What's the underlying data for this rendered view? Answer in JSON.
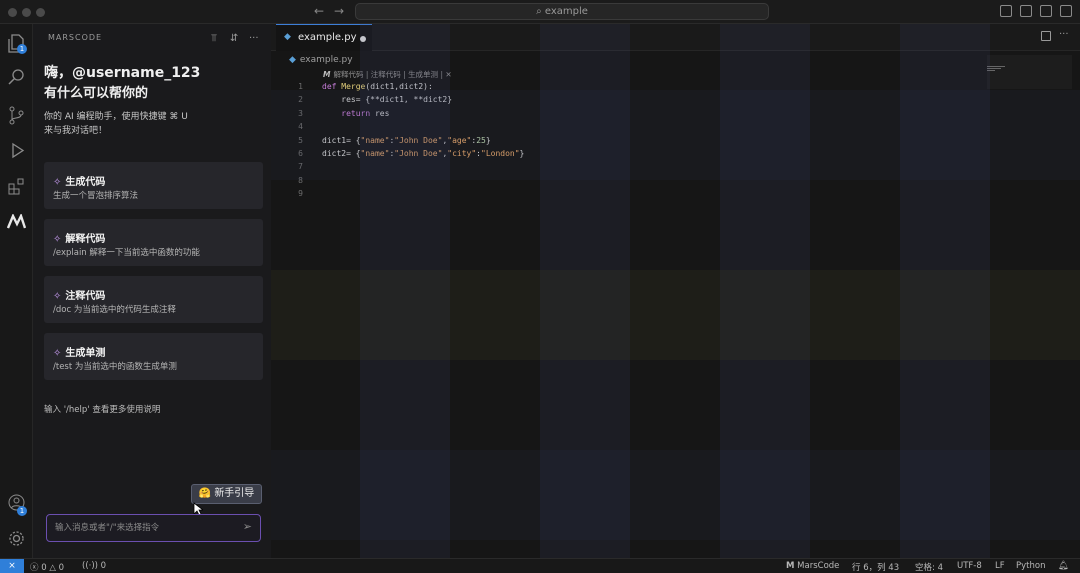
{
  "window": {
    "search_placeholder": "example"
  },
  "activity": {
    "icons": [
      "files-icon",
      "search-icon",
      "source-control-icon",
      "run-debug-icon",
      "extensions-icon",
      "marscode-icon",
      "account-icon",
      "settings-icon"
    ],
    "files_badge": "1",
    "account_badge": "1"
  },
  "panel": {
    "header": "MARSCODE",
    "greeting_line1": "嗨，@username_123",
    "greeting_line2": "有什么可以帮你的",
    "intro": "你的 AI 编程助手，使用快捷键 ⌘ U 来与我对话吧！",
    "cards": [
      {
        "title": "生成代码",
        "subtitle": "生成一个冒泡排序算法"
      },
      {
        "title": "解释代码",
        "subtitle": "/explain 解释一下当前选中函数的功能"
      },
      {
        "title": "注释代码",
        "subtitle": "/doc 为当前选中的代码生成注释"
      },
      {
        "title": "生成单测",
        "subtitle": "/test 为当前选中的函数生成单测"
      }
    ],
    "help_hint": "输入 '/help' 查看更多使用说明",
    "guide_button": "新手引导",
    "guide_emoji": "🤗",
    "input_placeholder": "输入消息或者\"/\"来选择指令"
  },
  "editor": {
    "tab_label": "example.py",
    "breadcrumb": "example.py",
    "codelens": [
      "解释代码",
      "注释代码",
      "生成单测"
    ],
    "codelens_brand": "M",
    "line_numbers": [
      "1",
      "2",
      "3",
      "4",
      "5",
      "6",
      "7",
      "8",
      "9"
    ]
  },
  "status": {
    "errors": "0",
    "warnings": "0",
    "ports": "0",
    "brand": "MarsCode",
    "position": "行 6，列 43",
    "spaces": "空格: 4",
    "encoding": "UTF-8",
    "eol": "LF",
    "language": "Python"
  },
  "colors": {
    "accent_blue": "#2f7fd9",
    "input_border": "#6b4fb0",
    "card_bg": "#26262b"
  }
}
